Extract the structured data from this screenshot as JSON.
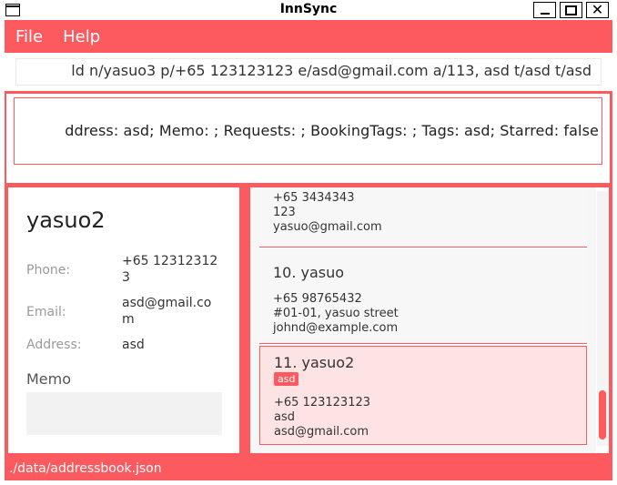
{
  "window": {
    "title": "InnSync",
    "icon": "window-app-icon",
    "controls": {
      "minimize_icon": "minimize-icon",
      "maximize_icon": "maximize-icon",
      "close_glyph": "✕"
    }
  },
  "menu": {
    "items": [
      "File",
      "Help"
    ]
  },
  "command_box": {
    "value": "ld n/yasuo3 p/+65 123123123 e/asd@gmail.com a/113, asd t/asd t/asd"
  },
  "result_display": {
    "text": "ddress: asd; Memo: ; Requests: ; BookingTags: ; Tags: asd; Starred: false"
  },
  "person_detail": {
    "name": "yasuo2",
    "phone_label": "Phone:",
    "phone_value": "+65 123123123",
    "email_label": "Email:",
    "email_value": "asd@gmail.com",
    "address_label": "Address:",
    "address_value": "asd",
    "memo_label": "Memo",
    "memo_value": ""
  },
  "person_list": {
    "cards": [
      {
        "index_name": "",
        "lines": [
          "+65 3434343",
          "123",
          "yasuo@gmail.com"
        ],
        "tags": [],
        "selected": false
      },
      {
        "index_name": "10.  yasuo",
        "lines": [
          "+65 98765432",
          "#01-01, yasuo street",
          "johnd@example.com"
        ],
        "tags": [],
        "selected": false
      },
      {
        "index_name": "11.  yasuo2",
        "lines": [
          "+65 123123123",
          "asd",
          "asd@gmail.com"
        ],
        "tags": [
          "asd"
        ],
        "selected": true
      }
    ]
  },
  "status_bar": {
    "text": "./data/addressbook.json"
  },
  "colors": {
    "accent": "#fd5a5f",
    "selected_card": "#fde3e4"
  }
}
